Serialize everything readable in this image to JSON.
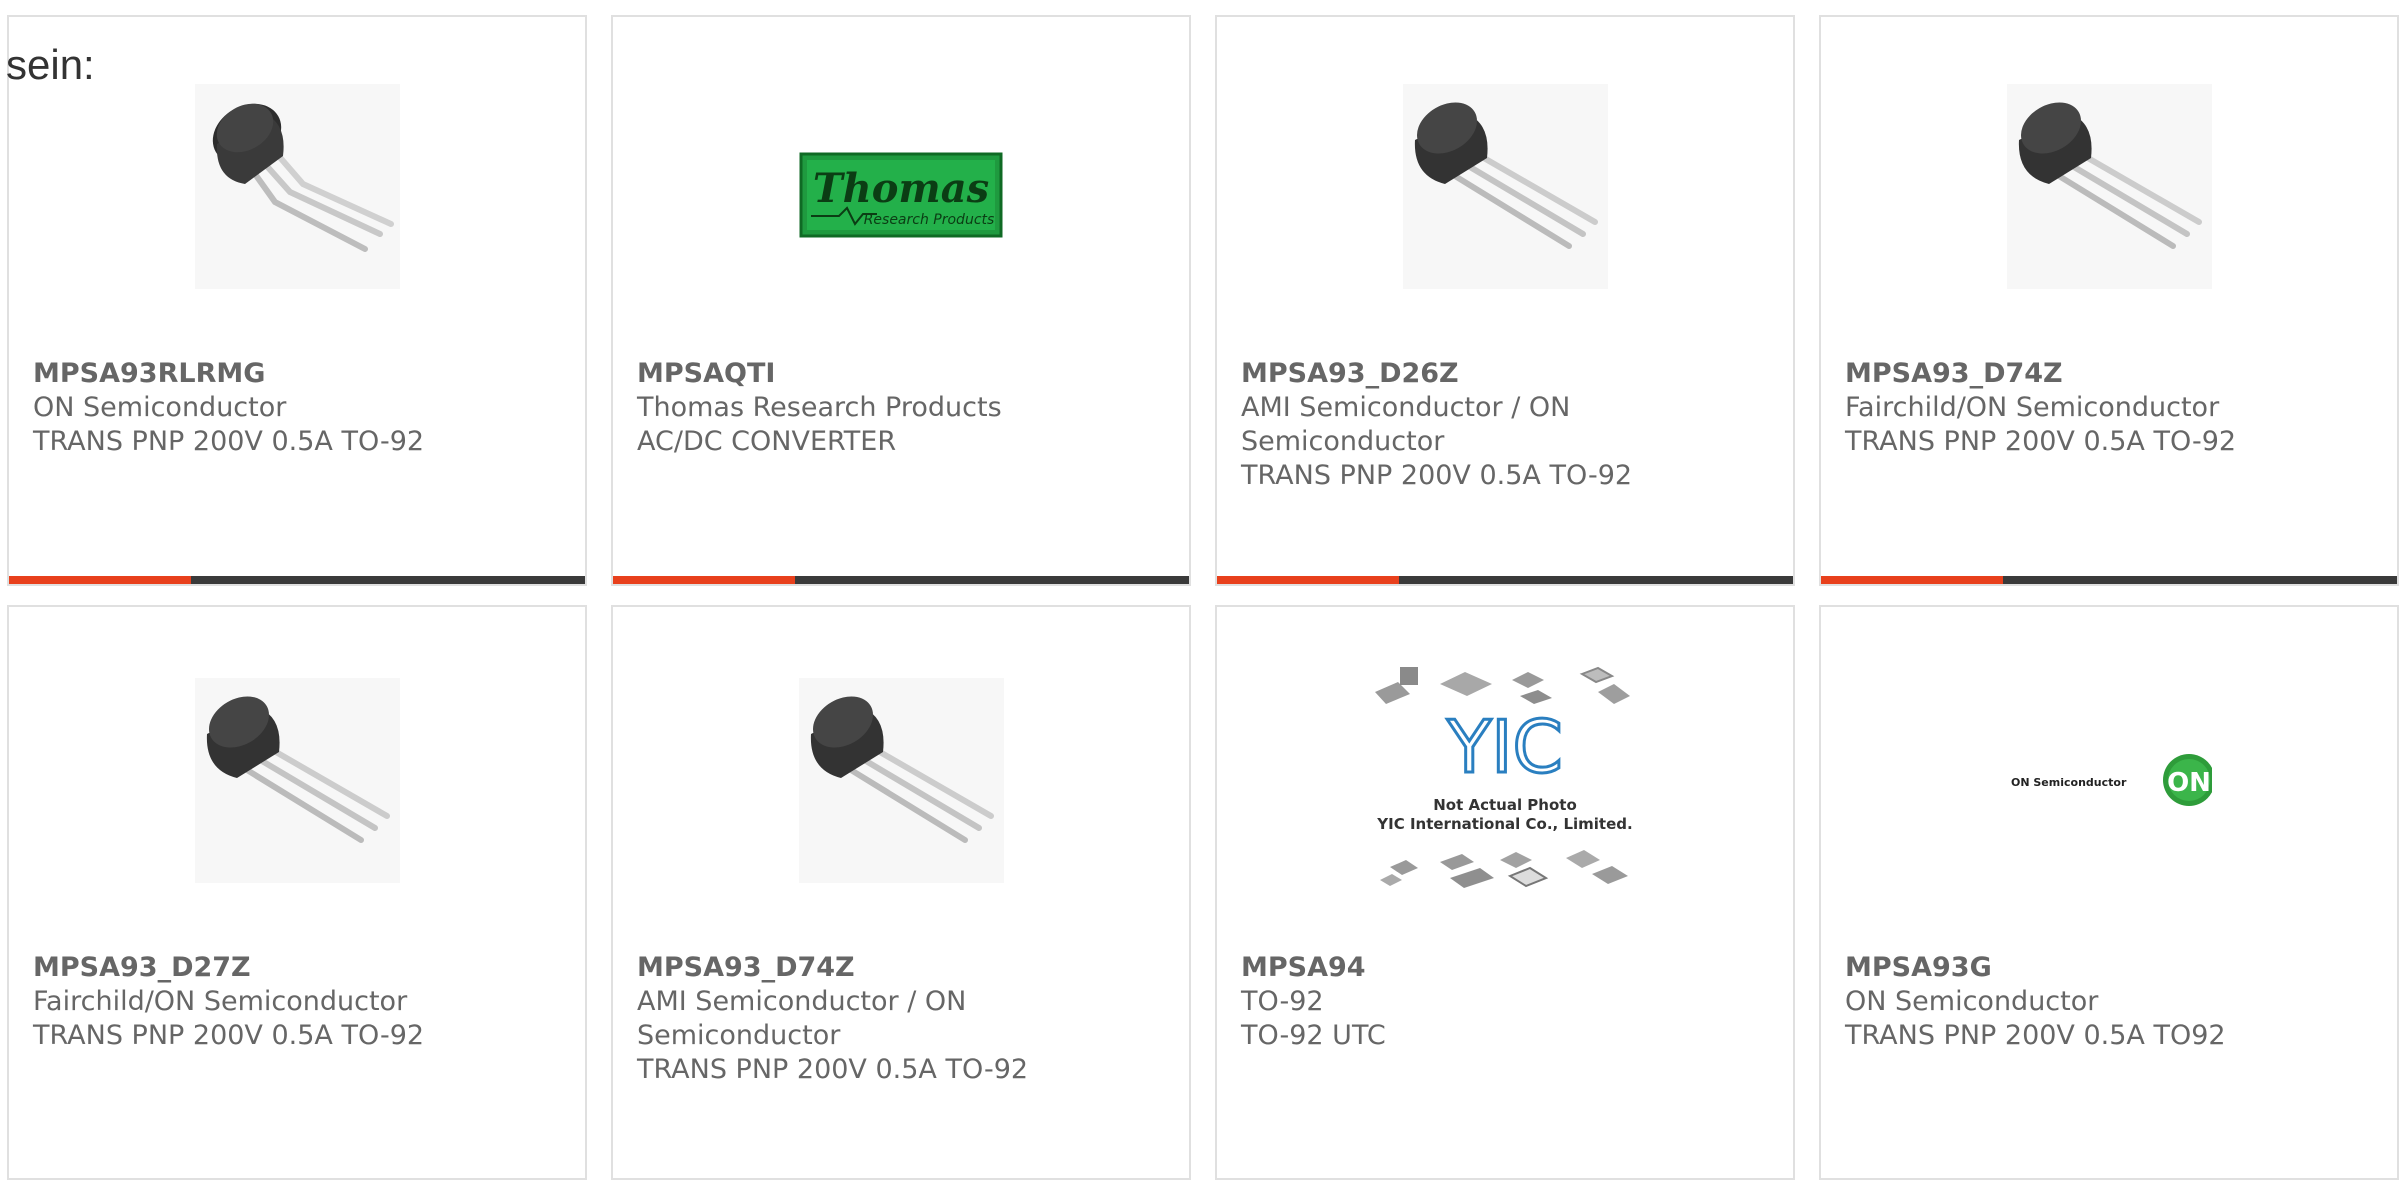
{
  "heading": "sein:",
  "colors": {
    "accent": "#e8401c",
    "bar": "#3a3a3a",
    "text": "#666666",
    "card_border": "#e0e0e0"
  },
  "products": [
    {
      "part": "MPSA93RLRMG",
      "maker": "ON Semiconductor",
      "desc": "TRANS PNP 200V 0.5A TO-92",
      "image": "transistor-to92-bent-leads"
    },
    {
      "part": "MPSAQTI",
      "maker": "Thomas Research Products",
      "desc": "AC/DC CONVERTER",
      "image": "thomas-research-logo",
      "logo_text": "Thomas",
      "logo_sub": "Research Products"
    },
    {
      "part": "MPSA93_D26Z",
      "maker": "AMI Semiconductor / ON Semiconductor",
      "desc": "TRANS PNP 200V 0.5A TO-92",
      "image": "transistor-to92"
    },
    {
      "part": "MPSA93_D74Z",
      "maker": "Fairchild/ON Semiconductor",
      "desc": "TRANS PNP 200V 0.5A TO-92",
      "image": "transistor-to92"
    },
    {
      "part": "MPSA93_D27Z",
      "maker": "Fairchild/ON Semiconductor",
      "desc": "TRANS PNP 200V 0.5A TO-92",
      "image": "transistor-to92"
    },
    {
      "part": "MPSA93_D74Z",
      "maker": "AMI Semiconductor / ON Semiconductor",
      "desc": "TRANS PNP 200V 0.5A TO-92",
      "image": "transistor-to92"
    },
    {
      "part": "MPSA94",
      "maker": "TO-92",
      "desc": "TO-92 UTC",
      "image": "yic-not-actual-photo",
      "logo_text": "YIC",
      "note_1": "Not Actual Photo",
      "note_2": "YIC International Co., Limited."
    },
    {
      "part": "MPSA93G",
      "maker": "ON Semiconductor",
      "desc": "TRANS PNP 200V 0.5A TO92",
      "image": "on-semiconductor-logo",
      "logo_text": "ON Semiconductor",
      "logo_mark": "ON"
    }
  ]
}
